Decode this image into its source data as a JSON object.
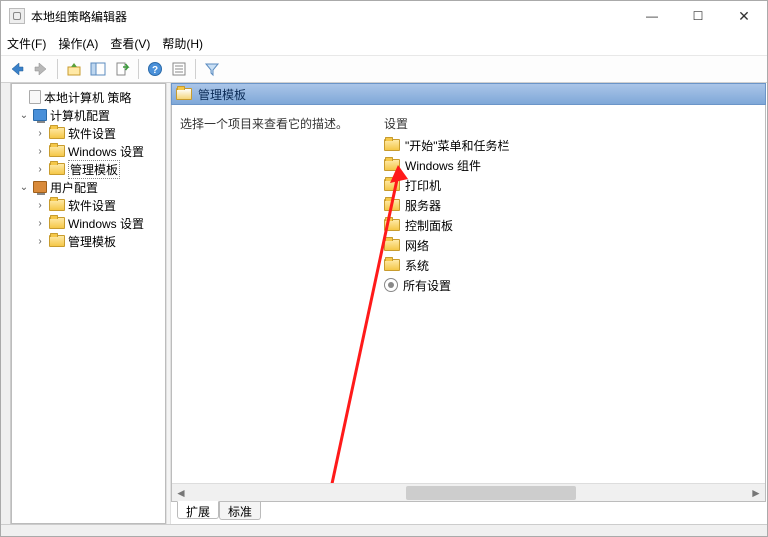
{
  "window": {
    "title": "本地组策略编辑器"
  },
  "menu": {
    "file": "文件(F)",
    "action": "操作(A)",
    "view": "查看(V)",
    "help": "帮助(H)"
  },
  "tree": {
    "root": "本地计算机 策略",
    "computer": "计算机配置",
    "user": "用户配置",
    "software": "软件设置",
    "windows": "Windows 设置",
    "admin": "管理模板"
  },
  "header": {
    "title": "管理模板"
  },
  "detail": {
    "desc": "选择一个项目来查看它的描述。",
    "col": "设置",
    "items": [
      "\"开始\"菜单和任务栏",
      "Windows 组件",
      "打印机",
      "服务器",
      "控制面板",
      "网络",
      "系统",
      "所有设置"
    ]
  },
  "tabs": {
    "ext": "扩展",
    "std": "标准"
  }
}
